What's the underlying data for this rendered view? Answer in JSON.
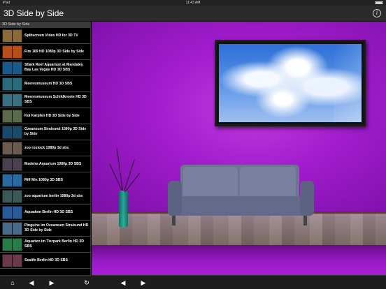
{
  "status_bar": {
    "time": "11:43 AM",
    "device": "iPad"
  },
  "header": {
    "title": "3D Side by Side",
    "info_icon": "info-icon"
  },
  "sidebar": {
    "section_title": "3D Side by Side",
    "items": [
      {
        "label": "Splitscreen Video HD for 3D TV",
        "thumb": "#8a6a3a"
      },
      {
        "label": "Fire 169 HD 1080p 3D Side by Side",
        "thumb": "#b5501a"
      },
      {
        "label": "Shark Reef Aquarium at Mandaley Bay Las Vegas HD 3D SBS",
        "thumb": "#1a5a8a"
      },
      {
        "label": "Meeresmuseum HD 3D SBS",
        "thumb": "#2a6a7a"
      },
      {
        "label": "Meeresmuseum Schildkroete HD 3D SBS",
        "thumb": "#3a7080"
      },
      {
        "label": "Koi Karpfen HD 3D Side by Side",
        "thumb": "#5a6a4a"
      },
      {
        "label": "Ozeaneum Stralsund 1080p 3D Side by Side",
        "thumb": "#1a4a6a"
      },
      {
        "label": "zoo rostock 1080p 3d sbs",
        "thumb": "#6a5a50"
      },
      {
        "label": "Madeira Aquarium 1080p 3D SBS",
        "thumb": "#4a4050"
      },
      {
        "label": "Riff Mix 1080p 3D SBS",
        "thumb": "#2a6aa0"
      },
      {
        "label": "zoo aquarium berlin 1080p 3d sbs",
        "thumb": "#3a5a5a"
      },
      {
        "label": "Aquadom Berlin HD 3D SBS",
        "thumb": "#2a5a9a"
      },
      {
        "label": "Pinguine im Ozeaneum Stralsund HD 3D Side by Side",
        "thumb": "#4a6a8a"
      },
      {
        "label": "Aquarien im Tierpark Berlin HD 3D SBS",
        "thumb": "#2a7a4a"
      },
      {
        "label": "Sealife Berlin HD 3D SBS",
        "thumb": "#6a3a4a"
      }
    ]
  },
  "toolbar": {
    "home": "⌂",
    "back": "◀",
    "forward": "▶",
    "reload": "↻",
    "main_back": "◀",
    "main_forward": "▶"
  }
}
